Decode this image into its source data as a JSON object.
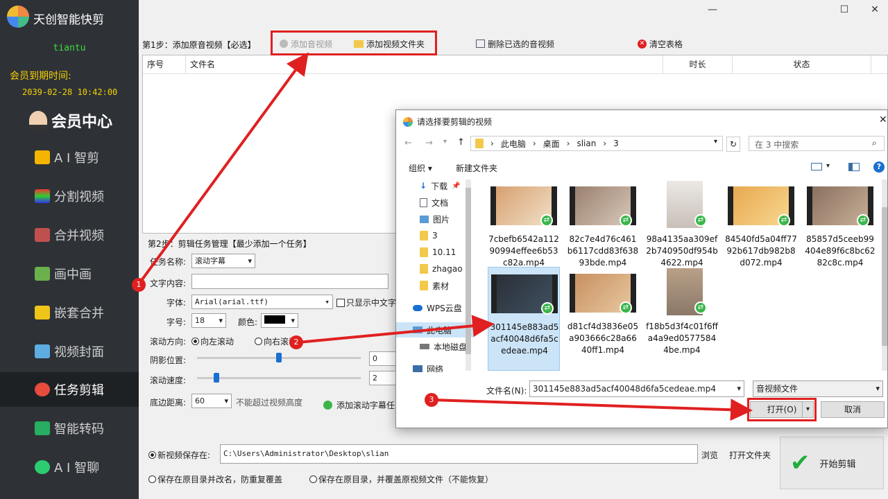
{
  "app": {
    "title": "天创智能快剪",
    "user": "tiantu",
    "expire_label": "会员到期时间:",
    "expire_date": "2039-02-28 10:42:00",
    "vip_label": "会员中心"
  },
  "nav": [
    {
      "label": "A I 智剪",
      "icon": "ai-edit-icon",
      "color": "#f5b400"
    },
    {
      "label": "分割视频",
      "icon": "split-video-icon",
      "color": "#3a7bd5"
    },
    {
      "label": "合并视频",
      "icon": "merge-video-icon",
      "color": "#c0504d"
    },
    {
      "label": "画中画",
      "icon": "picture-in-picture-icon",
      "color": "#6ab04c"
    },
    {
      "label": "嵌套合并",
      "icon": "nested-merge-icon",
      "color": "#f0c419"
    },
    {
      "label": "视频封面",
      "icon": "video-cover-icon",
      "color": "#5dade2"
    },
    {
      "label": "任务剪辑",
      "icon": "task-edit-icon",
      "color": "#e74c3c"
    },
    {
      "label": "智能转码",
      "icon": "smart-transcode-icon",
      "color": "#27ae60"
    },
    {
      "label": "A I 智聊",
      "icon": "ai-chat-icon",
      "color": "#2ecc71"
    }
  ],
  "window": {
    "minimize": "—",
    "maximize": "☐",
    "close": "✕"
  },
  "step1": {
    "label": "第1步：添加原音视频【必选】",
    "add_video": "添加音视频",
    "add_folder": "添加视频文件夹",
    "delete_selected": "删除已选的音视频",
    "clear_table": "清空表格",
    "columns": [
      "序号",
      "文件名",
      "时长",
      "状态"
    ]
  },
  "step2": {
    "label": "第2步：剪辑任务管理【最少添加一个任务】",
    "task_name_label": "任务名称:",
    "task_name_value": "滚动字幕",
    "text_content_label": "文字内容:",
    "text_content_value": "",
    "font_label": "字体:",
    "font_value": "Arial(arial.ttf)",
    "only_chinese_label": "只显示中文字",
    "size_label": "字号:",
    "size_value": "18",
    "color_label": "颜色:",
    "direction_label": "滚动方向:",
    "dir_left": "向左滚动",
    "dir_right": "向右滚动",
    "shadow_label": "阴影位置:",
    "shadow_value": "0",
    "speed_label": "滚动速度:",
    "speed_value": "2",
    "bottom_label": "底边距离:",
    "bottom_value": "60",
    "bottom_hint": "不能超过视频高度",
    "add_task": "添加滚动字幕任"
  },
  "save": {
    "new_path_label": "新视频保存在:",
    "path_value": "C:\\Users\\Administrator\\Desktop\\slian",
    "browse": "浏览",
    "open_folder": "打开文件夹",
    "rename_label": "保存在原目录并改名，防重复覆盖",
    "overwrite_label": "保存在原目录，并覆盖原视频文件（不能恢复）",
    "start": "开始剪辑"
  },
  "dialog": {
    "title": "请选择要剪辑的视频",
    "path": [
      "此电脑",
      "桌面",
      "slian",
      "3"
    ],
    "search_placeholder": "在 3 中搜索",
    "organize": "组织 ▾",
    "new_folder": "新建文件夹",
    "tree": [
      "下载",
      "文档",
      "图片",
      "3",
      "10.11",
      "zhagao",
      "素材",
      "WPS云盘",
      "此电脑",
      "本地磁盘",
      "网络"
    ],
    "files": [
      "7cbefb6542a11290994effee6b53c82a.mp4",
      "82c7e4d76c461b6117cdd83f63893bde.mp4",
      "98a4135aa309ef2b740950df954b4622.mp4",
      "84540fd5a04ff7792b617db982b8d072.mp4",
      "85857d5ceeb99404e89f6c8bc6282c8c.mp4",
      "301145e883ad5acf40048d6fa5cedeae.mp4",
      "d81cf4d3836e05a903666c28a6640ff1.mp4",
      "f18b5d3f4c01f6ffa4a9ed05775844be.mp4"
    ],
    "filename_label": "文件名(N):",
    "filename_value": "301145e883ad5acf40048d6fa5cedeae.mp4",
    "filetype_value": "音视频文件",
    "open": "打开(O)",
    "cancel": "取消"
  },
  "annotations": [
    "1",
    "2",
    "3"
  ],
  "colors": {
    "annotation_red": "#e02020",
    "sidebar_bg": "#2e3237",
    "vip_yellow": "#f5d000",
    "user_green": "#3ddc3d"
  }
}
